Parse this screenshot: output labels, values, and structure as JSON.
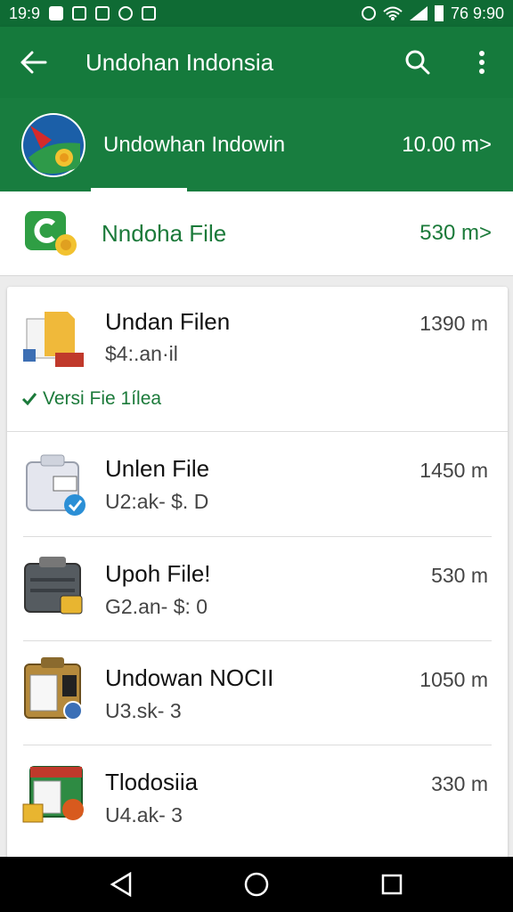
{
  "status_bar": {
    "time_left": "19:9",
    "time_right": "76 9:90"
  },
  "app_bar": {
    "title": "Undohan Indonsia"
  },
  "banner": {
    "name": "Undowhan Indowin",
    "size": "10.00 m>"
  },
  "top_item": {
    "name": "Nndoha File",
    "size": "530 m>"
  },
  "list": {
    "items": [
      {
        "title": "Undan Filen",
        "subtitle": "$4:.an·il",
        "size": "1390 m",
        "verified": "Versi Fie 1ílea"
      },
      {
        "title": "Unlen File",
        "subtitle": "U2:ak- $. D",
        "size": "1450 m"
      },
      {
        "title": "Upoh File!",
        "subtitle": "G2.an- $: 0",
        "size": "530 m"
      },
      {
        "title": "Undowan NOCII",
        "subtitle": "U3.sk- 3",
        "size": "1050 m"
      },
      {
        "title": "Tlodosiia",
        "subtitle": "U4.ak- 3",
        "size": "330 m"
      }
    ]
  },
  "colors": {
    "status_bar": "#0f6b34",
    "app_bar": "#157a3c",
    "accent_green": "#1b7a3a"
  }
}
